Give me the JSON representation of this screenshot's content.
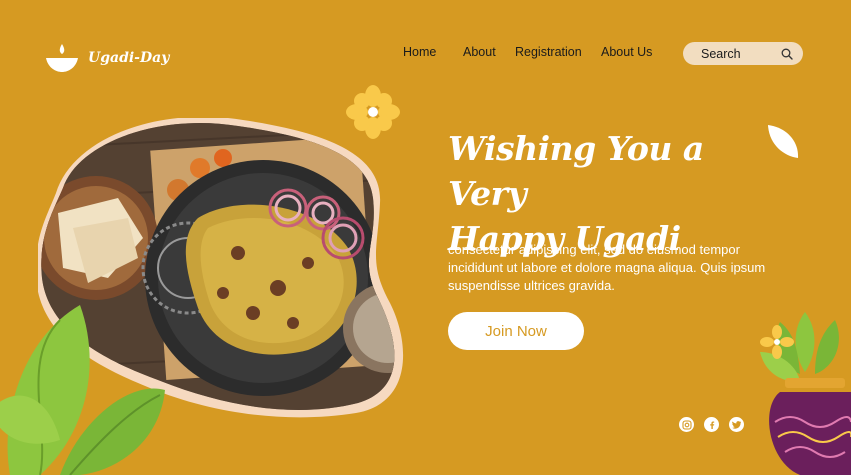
{
  "brand": {
    "name": "Ugadi-Day"
  },
  "nav": {
    "items": [
      {
        "label": "Home"
      },
      {
        "label": "About"
      },
      {
        "label": "Registration"
      },
      {
        "label": "About Us"
      }
    ]
  },
  "search": {
    "placeholder": "Search"
  },
  "hero": {
    "headline_line1": "Wishing You a Very",
    "headline_line2": "Happy Ugadi",
    "body": "consectetur adipiscing elit, sed do eiusmod tempor incididunt ut labore et dolore magna aliqua. Quis ipsum suspendisse ultrices gravida.",
    "cta": "Join Now"
  },
  "socials": [
    {
      "icon": "instagram-icon"
    },
    {
      "icon": "facebook-icon"
    },
    {
      "icon": "twitter-icon"
    }
  ],
  "colors": {
    "background": "#D69A22",
    "accent_light": "#F2DDC0",
    "leaf_green": "#8DC63F",
    "pot_purple": "#6B1F5C"
  }
}
